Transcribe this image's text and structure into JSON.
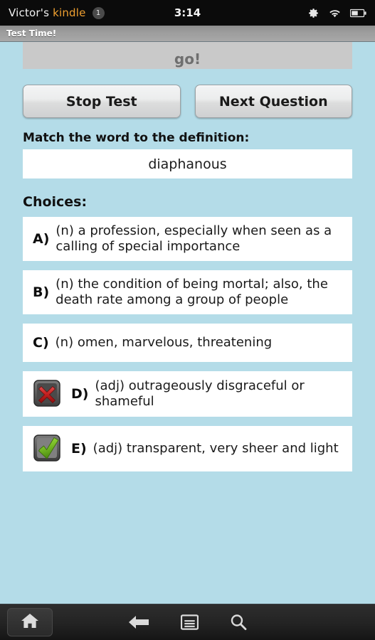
{
  "statusbar": {
    "device_owner": "Victor's ",
    "device_brand": "kindle",
    "notification_count": "1",
    "clock": "3:14",
    "icons": [
      "gear-icon",
      "wifi-icon",
      "battery-icon"
    ]
  },
  "titlebar": {
    "app_title": "Test Time!"
  },
  "timer": {
    "text": "go!"
  },
  "toolbar": {
    "stop_label": "Stop Test",
    "next_label": "Next Question"
  },
  "question": {
    "prompt": "Match the word to the definition:",
    "word": "diaphanous",
    "choices_label": "Choices:"
  },
  "choices": [
    {
      "letter": "A)",
      "text": "(n) a profession, especially when seen as a calling of special importance",
      "marker": "none"
    },
    {
      "letter": "B)",
      "text": "(n) the condition of being mortal; also, the death rate among a group of people",
      "marker": "none"
    },
    {
      "letter": "C)",
      "text": "(n) omen, marvelous, threatening",
      "marker": "none"
    },
    {
      "letter": "D)",
      "text": "(adj) outrageously disgraceful or shameful",
      "marker": "wrong-answer-icon"
    },
    {
      "letter": "E)",
      "text": "(adj) transparent, very sheer and light",
      "marker": "correct-answer-icon"
    }
  ],
  "navbar": {
    "items": [
      "home-icon",
      "back-icon",
      "menu-icon",
      "search-icon"
    ]
  },
  "colors": {
    "page_background": "#b4dce8",
    "brand_orange": "#f0a030",
    "card_background": "#ffffff",
    "correct_green": "#76bc2a",
    "wrong_red": "#c22b2b"
  }
}
